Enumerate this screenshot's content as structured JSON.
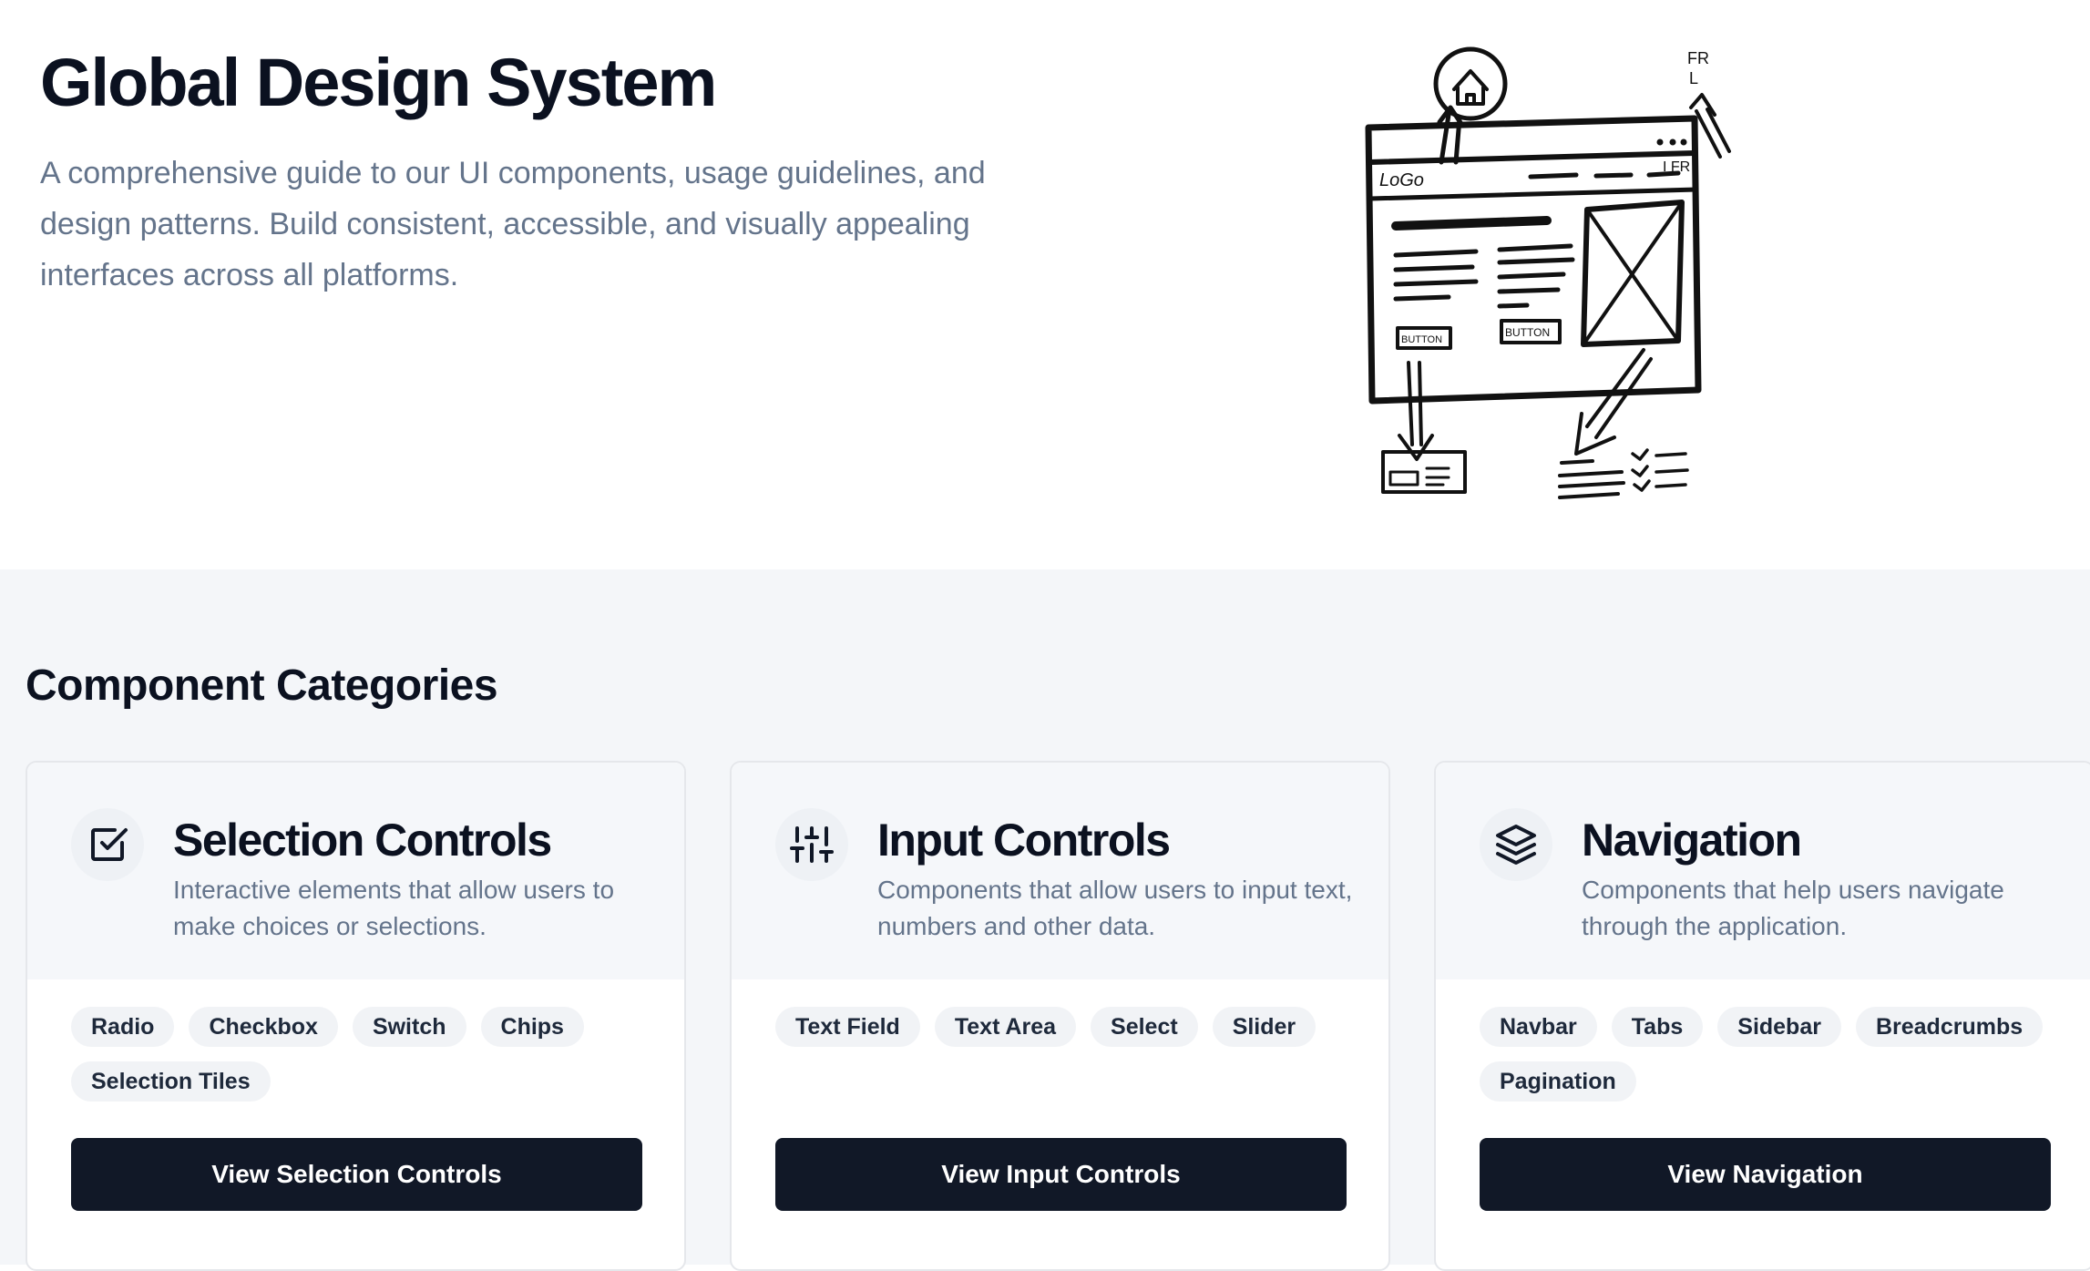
{
  "hero": {
    "title": "Global Design System",
    "description": "A comprehensive guide to our UI components, usage guidelines, and design patterns. Build consistent, accessible, and visually appealing interfaces across all platforms.",
    "illustration": {
      "logo_text": "LoGo",
      "lang_text": "FR",
      "lang_text_alt": "I FR",
      "lang_small": "L",
      "button_text": "BUTTON"
    }
  },
  "categories": {
    "title": "Component Categories",
    "cards": [
      {
        "icon": "checkbox-icon",
        "title": "Selection Controls",
        "description": "Interactive elements that allow users to make choices or selections.",
        "chips": [
          "Radio",
          "Checkbox",
          "Switch",
          "Chips",
          "Selection Tiles"
        ],
        "button": "View Selection Controls"
      },
      {
        "icon": "sliders-icon",
        "title": "Input Controls",
        "description": "Components that allow users to input text, numbers and other data.",
        "chips": [
          "Text Field",
          "Text Area",
          "Select",
          "Slider"
        ],
        "button": "View Input Controls"
      },
      {
        "icon": "layers-icon",
        "title": "Navigation",
        "description": "Components that help users navigate through the application.",
        "chips": [
          "Navbar",
          "Tabs",
          "Sidebar",
          "Breadcrumbs",
          "Pagination"
        ],
        "button": "View Navigation"
      }
    ]
  }
}
